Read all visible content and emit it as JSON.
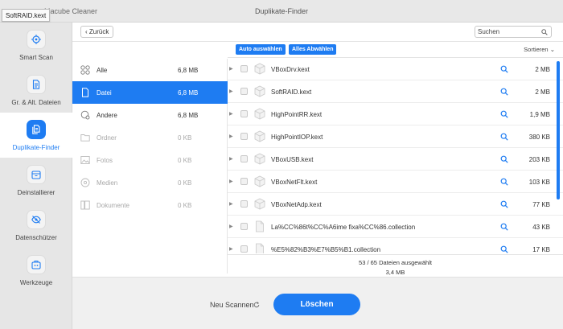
{
  "window": {
    "app_name": "Macube Cleaner",
    "title": "Duplikate-Finder",
    "tooltip": "SoftRAID.kext"
  },
  "sidebar": {
    "items": [
      {
        "label": "Smart Scan",
        "icon": "target-icon"
      },
      {
        "label": "Gr. & Alt. Dateien",
        "icon": "document-icon"
      },
      {
        "label": "Duplikate-Finder",
        "icon": "duplicate-icon"
      },
      {
        "label": "Deinstallierer",
        "icon": "uninstall-icon"
      },
      {
        "label": "Datenschützer",
        "icon": "eye-slash-icon"
      },
      {
        "label": "Werkzeuge",
        "icon": "toolbox-icon"
      }
    ],
    "active_index": 2
  },
  "topbar": {
    "back_label": "Zurück",
    "search_placeholder": "Suchen"
  },
  "categories": [
    {
      "label": "Alle",
      "size": "6,8 MB",
      "state": "normal",
      "icon": "grid-icon"
    },
    {
      "label": "Datei",
      "size": "6,8 MB",
      "state": "active",
      "icon": "file-icon"
    },
    {
      "label": "Andere",
      "size": "6,8 MB",
      "state": "normal",
      "icon": "other-icon"
    },
    {
      "label": "Ordner",
      "size": "0 KB",
      "state": "disabled",
      "icon": "folder-icon"
    },
    {
      "label": "Fotos",
      "size": "0 KB",
      "state": "disabled",
      "icon": "photo-icon"
    },
    {
      "label": "Medien",
      "size": "0 KB",
      "state": "disabled",
      "icon": "media-icon"
    },
    {
      "label": "Dokumente",
      "size": "0 KB",
      "state": "disabled",
      "icon": "document-icon"
    }
  ],
  "file_header": {
    "select_all": "Auto auswählen",
    "deselect_all": "Alles Abwählen",
    "sort": "Sortieren"
  },
  "files": [
    {
      "name": "VBoxDrv.kext",
      "size": "2 MB",
      "icon": "package-icon"
    },
    {
      "name": "SoftRAID.kext",
      "size": "2 MB",
      "icon": "package-icon"
    },
    {
      "name": "HighPointRR.kext",
      "size": "1,9 MB",
      "icon": "package-icon"
    },
    {
      "name": "HighPointIOP.kext",
      "size": "380 KB",
      "icon": "package-icon"
    },
    {
      "name": "VBoxUSB.kext",
      "size": "203 KB",
      "icon": "package-icon"
    },
    {
      "name": "VBoxNetFlt.kext",
      "size": "103 KB",
      "icon": "package-icon"
    },
    {
      "name": "VBoxNetAdp.kext",
      "size": "77 KB",
      "icon": "package-icon"
    },
    {
      "name": "La%CC%86t%CC%A6ime fixa%CC%86.collection",
      "size": "43 KB",
      "icon": "file-icon"
    },
    {
      "name": "%E5%82%B3%E7%B5%B1.collection",
      "size": "17 KB",
      "icon": "file-icon"
    }
  ],
  "selection": {
    "count_text": "53 / 65 Dateien ausgewählt",
    "size_text": "3,4 MB"
  },
  "footer": {
    "rescan_label": "Neu Scannen",
    "delete_label": "Löschen"
  },
  "colors": {
    "accent": "#1e7cf2"
  }
}
